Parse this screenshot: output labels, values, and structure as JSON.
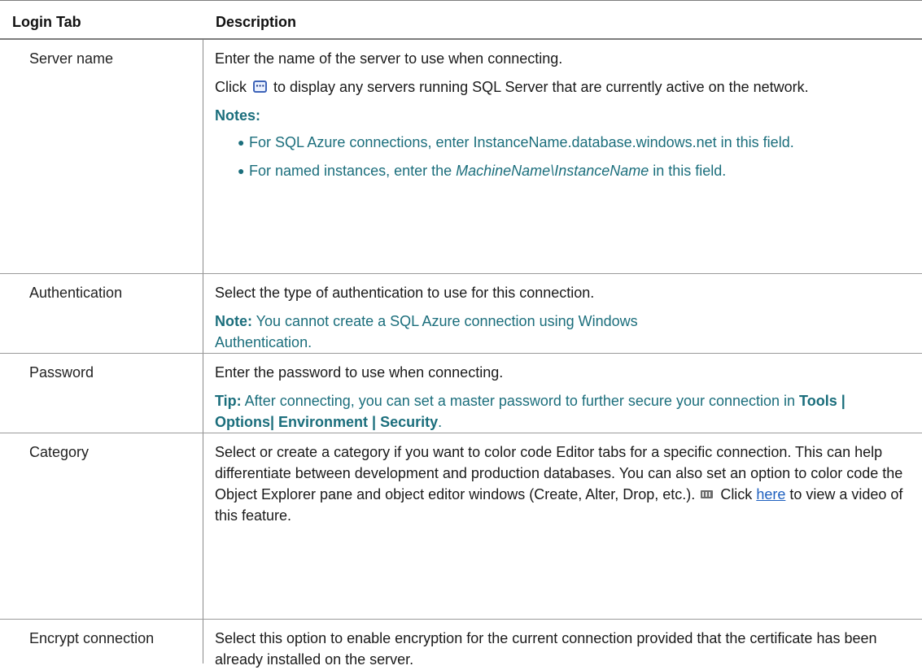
{
  "header": {
    "col1": "Login Tab",
    "col2": "Description"
  },
  "rows": [
    {
      "label": "Server name",
      "line1": "Enter the name of the server to use when connecting.",
      "click_before": "Click ",
      "click_after": " to display any servers running SQL Server that are currently active on the network.",
      "notes_title": "Notes:",
      "note1": "For SQL Azure connections, enter InstanceName.database.windows.net in this field.",
      "note2_before": "For named instances, enter the ",
      "note2_italic": "MachineName\\InstanceName",
      "note2_after": " in this field."
    },
    {
      "label": "Authentication",
      "line1": "Select the type of authentication to use for this connection.",
      "note_label": "Note:",
      "note_text": " You cannot create a SQL Azure connection using Windows Authentication."
    },
    {
      "label": "Password",
      "line1": "Enter the password to use when connecting.",
      "tip_label": "Tip:",
      "tip_text": " After connecting, you can set a master password to further secure your connection in ",
      "tip_path": "Tools | Options| Environment | Security",
      "tip_end": "."
    },
    {
      "label": "Category",
      "text": "Select or create a category if you want to color code Editor tabs for a specific connection. This can help differentiate between development and production databases. You can also set an option to color code the Object Explorer pane and object editor windows (Create, Alter, Drop, etc.).",
      "click_text": " Click ",
      "link_text": "here",
      "after_link": " to view a video of this feature."
    },
    {
      "label": "Encrypt connection",
      "text": "Select this option to enable encryption for the current connection provided that the certificate has been already installed on the server."
    }
  ]
}
